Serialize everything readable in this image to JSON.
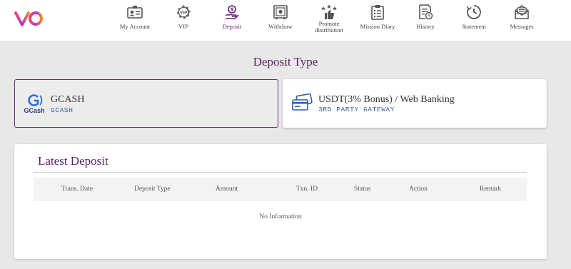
{
  "brand": {
    "accent": "#6a1b7b",
    "logo_colors": [
      "#e8437a",
      "#f28c28",
      "#8b2fc9"
    ]
  },
  "nav": {
    "items": [
      {
        "label": "My Account",
        "icon": "id-card-icon"
      },
      {
        "label": "VIP",
        "icon": "vip-badge-icon"
      },
      {
        "label": "Deposit",
        "icon": "deposit-hand-coin-icon",
        "active": true
      },
      {
        "label": "Withdraw",
        "icon": "safe-icon"
      },
      {
        "label": "Promote distribution",
        "icon": "thumbs-up-stars-icon"
      },
      {
        "label": "Mission Diary",
        "icon": "clipboard-icon"
      },
      {
        "label": "History",
        "icon": "document-clock-icon"
      },
      {
        "label": "Statement",
        "icon": "clock-icon"
      },
      {
        "label": "Messages",
        "icon": "envelope-icon"
      }
    ]
  },
  "deposit_type": {
    "title": "Deposit Type",
    "options": [
      {
        "title": "GCASH",
        "subtitle": "GCASH",
        "logo_text": "GCash",
        "selected": true
      },
      {
        "title": "USDT(3% Bonus) / Web Banking",
        "subtitle": "3RD PARTY GATEWAY",
        "selected": false
      }
    ]
  },
  "latest_deposit": {
    "title": "Latest Deposit",
    "columns": [
      "Trans. Date",
      "Deposit Type",
      "Amount",
      "Txn. ID",
      "Status",
      "Action",
      "Remark"
    ],
    "empty_text": "No Information"
  }
}
